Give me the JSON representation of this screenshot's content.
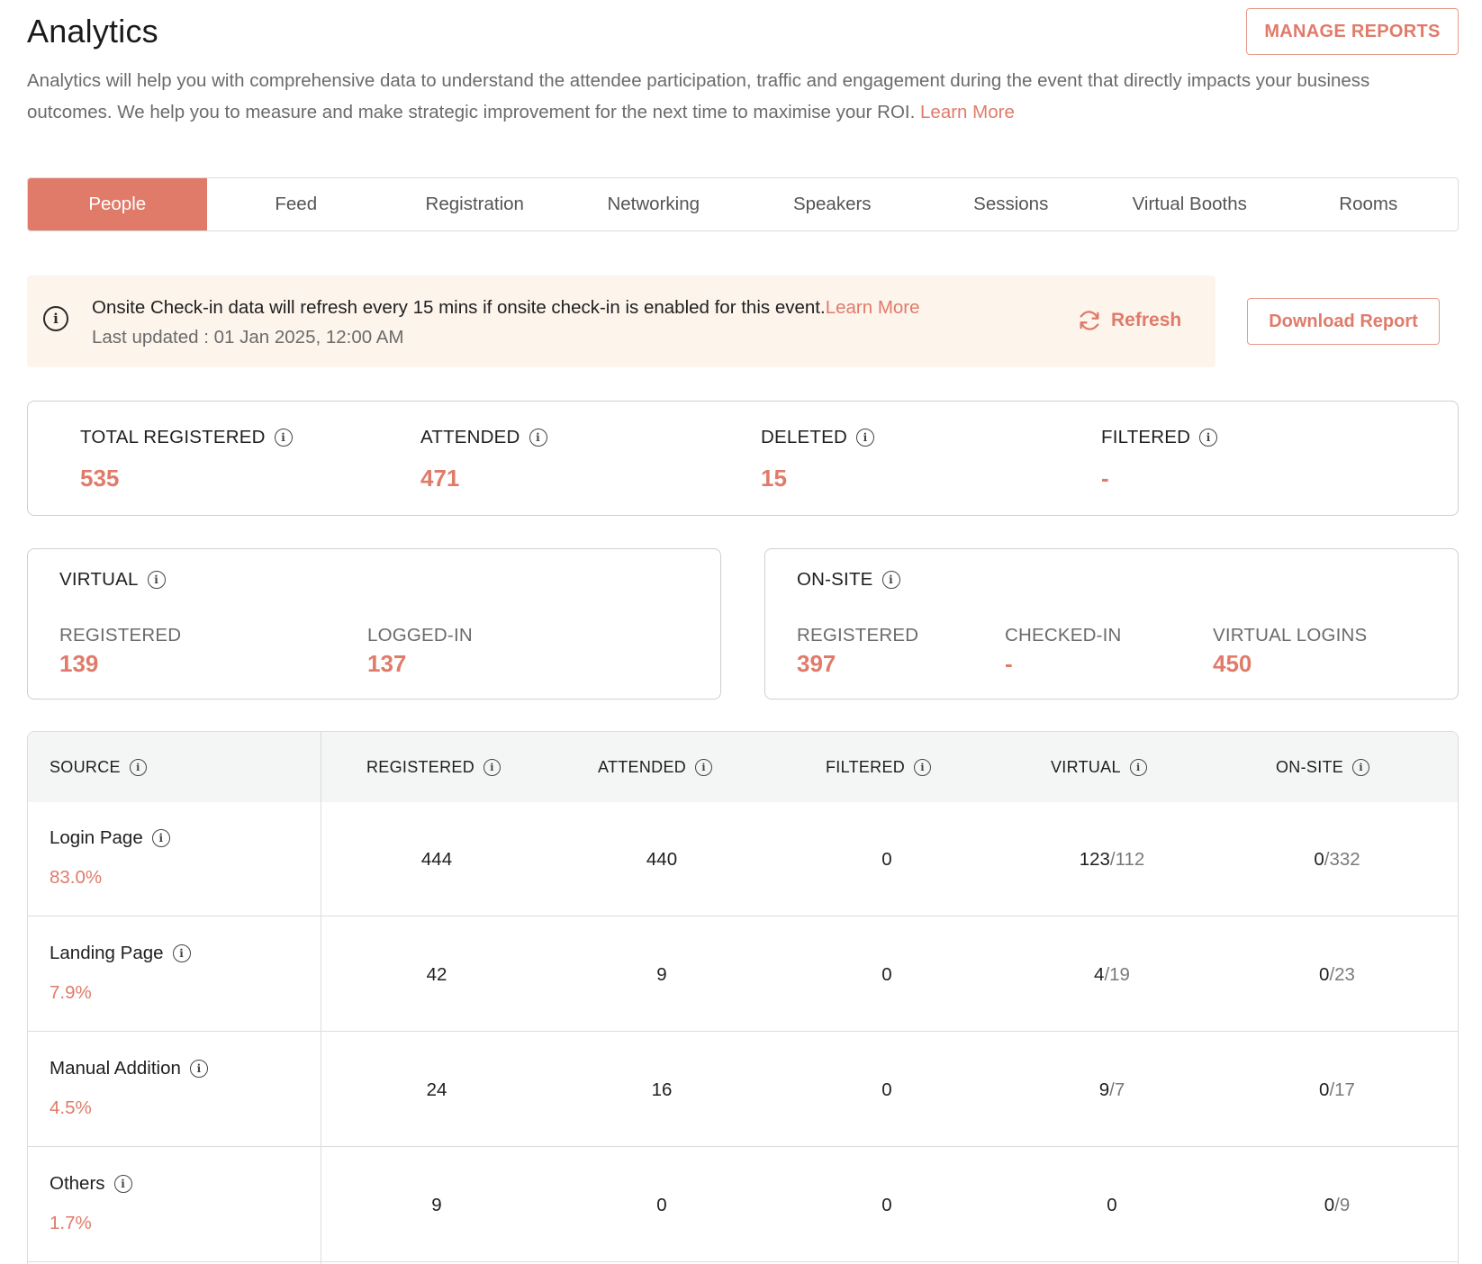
{
  "header": {
    "title": "Analytics",
    "manage_reports_label": "MANAGE REPORTS",
    "description": "Analytics will help you with comprehensive data to understand the attendee participation, traffic and engagement during the event that directly impacts your business outcomes. We help you to measure and make strategic improvement for the next time to maximise your ROI.",
    "learn_more": "Learn More"
  },
  "tabs": [
    "People",
    "Feed",
    "Registration",
    "Networking",
    "Speakers",
    "Sessions",
    "Virtual Booths",
    "Rooms"
  ],
  "active_tab": "People",
  "notice": {
    "message": "Onsite Check-in data will refresh every 15 mins if onsite check-in is enabled for this event.",
    "learn_more": "Learn More",
    "last_updated": "Last updated : 01 Jan 2025, 12:00 AM",
    "refresh_label": "Refresh"
  },
  "download_report_label": "Download Report",
  "totals": [
    {
      "label": "TOTAL REGISTERED",
      "value": "535"
    },
    {
      "label": "ATTENDED",
      "value": "471"
    },
    {
      "label": "DELETED",
      "value": "15"
    },
    {
      "label": "FILTERED",
      "value": "-"
    }
  ],
  "virtual": {
    "title": "VIRTUAL",
    "stats": [
      {
        "label": "REGISTERED",
        "value": "139"
      },
      {
        "label": "LOGGED-IN",
        "value": "137"
      }
    ]
  },
  "onsite": {
    "title": "ON-SITE",
    "stats": [
      {
        "label": "REGISTERED",
        "value": "397"
      },
      {
        "label": "CHECKED-IN",
        "value": "-"
      },
      {
        "label": "VIRTUAL LOGINS",
        "value": "450"
      }
    ]
  },
  "table": {
    "headers": [
      "SOURCE",
      "REGISTERED",
      "ATTENDED",
      "FILTERED",
      "VIRTUAL",
      "ON-SITE"
    ],
    "rows": [
      {
        "source": "Login Page",
        "percent": "83.0%",
        "registered": "444",
        "attended": "440",
        "filtered": "0",
        "virtual_a": "123",
        "virtual_b": "/112",
        "onsite_a": "0",
        "onsite_b": "/332"
      },
      {
        "source": "Landing Page",
        "percent": "7.9%",
        "registered": "42",
        "attended": "9",
        "filtered": "0",
        "virtual_a": "4",
        "virtual_b": "/19",
        "onsite_a": "0",
        "onsite_b": "/23"
      },
      {
        "source": "Manual Addition",
        "percent": "4.5%",
        "registered": "24",
        "attended": "16",
        "filtered": "0",
        "virtual_a": "9",
        "virtual_b": "/7",
        "onsite_a": "0",
        "onsite_b": "/17"
      },
      {
        "source": "Others",
        "percent": "1.7%",
        "registered": "9",
        "attended": "0",
        "filtered": "0",
        "virtual_a": "0",
        "virtual_b": "",
        "onsite_a": "0",
        "onsite_b": "/9"
      }
    ]
  },
  "colors": {
    "accent": "#e07b6a",
    "notice_bg": "#fdf4ec"
  }
}
